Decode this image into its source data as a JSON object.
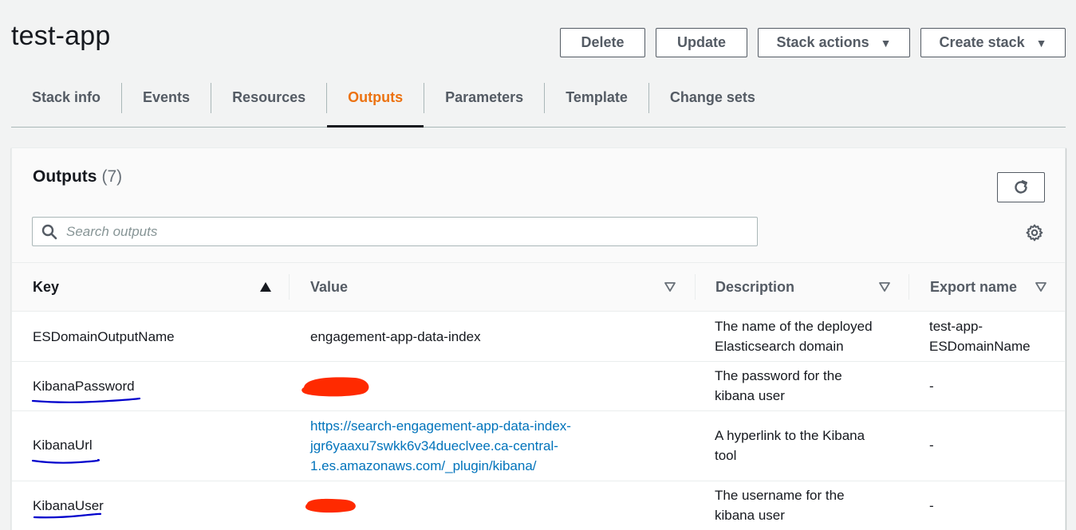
{
  "header": {
    "title": "test-app"
  },
  "actions": {
    "delete_label": "Delete",
    "update_label": "Update",
    "stack_actions_label": "Stack actions",
    "create_stack_label": "Create stack"
  },
  "tabs": [
    {
      "label": "Stack info"
    },
    {
      "label": "Events"
    },
    {
      "label": "Resources"
    },
    {
      "label": "Outputs"
    },
    {
      "label": "Parameters"
    },
    {
      "label": "Template"
    },
    {
      "label": "Change sets"
    }
  ],
  "outputs": {
    "title": "Outputs",
    "count": "(7)",
    "search_placeholder": "Search outputs",
    "columns": {
      "key": "Key",
      "value": "Value",
      "description": "Description",
      "export_name": "Export name"
    },
    "rows": [
      {
        "key": "ESDomainOutputName",
        "value": "engagement-app-data-index",
        "description_line1": "The name of the deployed",
        "description_line2": "Elasticsearch domain",
        "export_line1": "test-app-",
        "export_line2": "ESDomainName"
      },
      {
        "key": "KibanaPassword",
        "value": "",
        "description_line1": "The password for the",
        "description_line2": "kibana user",
        "export": "-"
      },
      {
        "key": "KibanaUrl",
        "value_line1": "https://search-engagement-app-data-index-",
        "value_line2": "jgr6yaaxu7swkk6v34dueclvee.ca-central-",
        "value_line3": "1.es.amazonaws.com/_plugin/kibana/",
        "description_line1": "A hyperlink to the Kibana",
        "description_line2": "tool",
        "export": "-"
      },
      {
        "key": "KibanaUser",
        "value": "",
        "description_line1": "The username for the",
        "description_line2": "kibana user",
        "export": "-"
      }
    ]
  },
  "colors": {
    "accent": "#ec7211",
    "link": "#0073bb",
    "redaction": "#ff2a00",
    "annotation": "#0000cc"
  }
}
